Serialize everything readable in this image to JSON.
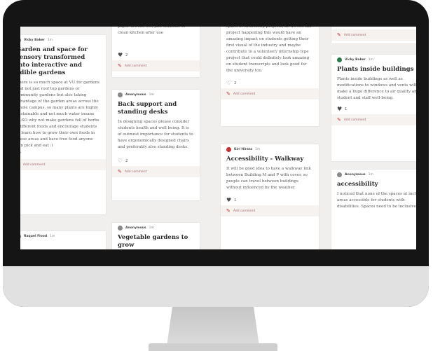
{
  "cards": {
    "gardens": {
      "author": "Vicky Baker",
      "time": "1m",
      "title": "Garden and space for sensory transformed into interactive and edible gardens",
      "body": "There is so much space at VU for gardens and not just roof top gardens or community gardens but also taking advantage of the garden areas across the whole campus. so many plants are highly sustainable and not much water insane ALSO why not make gardens full of herbs - different foods and encourage students to learn how to grow their own foods in these areas and have free food anyone can pick and eat :)",
      "likes": "",
      "comment": "Add comment"
    },
    "kitchen": {
      "body": "paper towels, etc, just students to clean kitchen after use",
      "likes": "2",
      "comment": "Add comment"
    },
    "desks": {
      "author": "Anonymous",
      "time": "1m",
      "title": "Back support and standing desks",
      "body": "In designing spaces please consider students health and well being. It is of outmost importance for students to have ergonomically designed chairs and preferably also standing desks.",
      "likes": "2",
      "comment": "Add comment"
    },
    "vegetable": {
      "author": "Anonymous",
      "time": "1m",
      "title": "Vegetable gardens to grow"
    },
    "internship": {
      "body": "space or internship projects, as we see the project happening this would have an amazing impact on students getting their first visual of the industry and maybe contribute to a volunteer/ internship type project that could definitely look amazing on student transcripts and look good for the university too.",
      "likes": "2",
      "comment": "Add comment"
    },
    "walkway": {
      "author": "Kiri Hirata",
      "time": "1m",
      "title": "Accessibility - Walkway",
      "body": "It will be good idea to have a walkway link between Building M and P with cover, so people can travel between buildings without influenced by the weather.",
      "likes": "1",
      "comment": "Add comment"
    },
    "top_right": {
      "comment": "Add comment"
    },
    "plants": {
      "author": "Vicky Baker",
      "time": "1m",
      "title": "Plants inside buildings",
      "body": "Plants inside buildings as well as modifications to windows and vents will make a huge difference to air quality and student and staff well-being.",
      "likes": "1",
      "comment": "Add comment"
    },
    "accessibility": {
      "author": "Anonymous",
      "time": "1m",
      "title": "accessibility",
      "body": "I noticed that none of the spaces at include areas accessible for students with disabilities. Spaces need to be inclusive."
    },
    "bottom_left": {
      "author": "Raquel Flood",
      "time": "1m"
    }
  },
  "colors": {
    "accent": "#c1312f",
    "screen_bg": "#f1efed",
    "bezel": "#151515"
  }
}
